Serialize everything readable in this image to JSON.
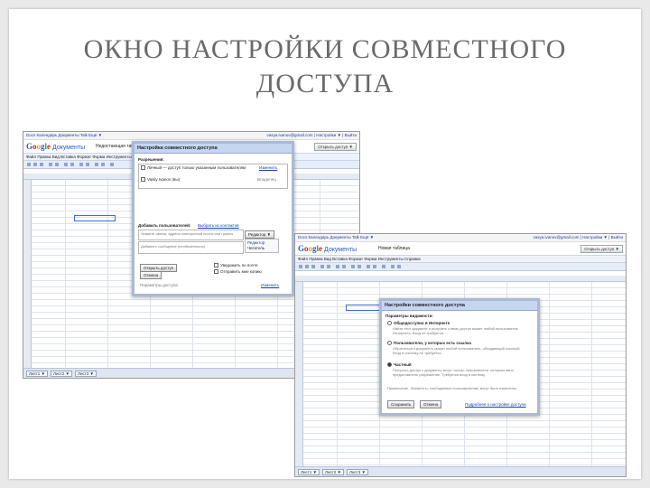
{
  "slide": {
    "title_line1": "ОКНО НАСТРОЙКИ СОВМЕСТНОГО",
    "title_line2": "ДОСТУПА"
  },
  "shot1": {
    "top_links": "Docs  Календарь  Документы  Talk  Ещё ▼",
    "account": "vasya.ivanov@gmail.com | Настройки ▼ | Выйти",
    "app_name": "Документы",
    "doc_name": "Недостающая таблица",
    "share_button": "Открыть доступ ▼",
    "menu": "Файл  Правка  Вид  Вставка  Формат  Форма  Инструменты  Справка",
    "sheet_tabs": [
      "Лист1 ▼",
      "Лист2 ▼",
      "Лист3 ▼"
    ],
    "dialog": {
      "title": "Настройка совместного доступа",
      "permissions_label": "Разрешения:",
      "perm_row1": "Личный — доступ только указанным пользователям",
      "perm_row1_action": "Изменить",
      "perm_row2": "Vasily Ivanov (вы)",
      "perm_row2_role": "Владелец",
      "add_people_label": "Добавить пользователей:",
      "add_people_link": "Выбрать из контактов",
      "email_placeholder": "Укажите имена, адреса электронной почты или группы",
      "role_select": "Редактор ▼",
      "role_options": [
        "Редактор",
        "Читатель"
      ],
      "message_placeholder": "Добавить сообщение (необязательно)",
      "share_btn": "Открыть доступ",
      "cancel_btn": "Отмена",
      "notify_check": "Уведомить по почте",
      "copy_check": "Отправить мне копию",
      "footer_left": "Параметры доступа",
      "footer_link": "Изменить"
    }
  },
  "shot2": {
    "top_links": "Docs  Календарь  Документы  Talk  Ещё ▼",
    "account": "vasya.ivanov@gmail.com | Настройки ▼ | Выйти",
    "app_name": "Документы",
    "doc_name": "Новая таблица",
    "share_button": "Открыть доступ ▼",
    "menu": "Файл  Правка  Вид  Вставка  Формат  Форма  Инструменты  Справка",
    "sheet_tabs": [
      "Лист1 ▼",
      "Лист2 ▼",
      "Лист3 ▼"
    ],
    "dialog": {
      "title": "Настройки совместного доступа",
      "visibility_label": "Параметры видимости:",
      "opt1_title": "Общедоступно в Интернете",
      "opt1_desc": "Найти этот документ и получить к нему доступ может любой пользователь Интернета. Вход не требуется.",
      "opt2_title": "Пользователи, у которых есть ссылка",
      "opt2_desc": "Обратиться к документу может любой пользователь, обладающий ссылкой. Вход в систему не требуется.",
      "opt3_title": "Частный",
      "opt3_desc": "Получить доступ к документу могут только пользователи, которым явно предоставлено разрешение. Требуется вход в систему.",
      "note": "Примечание. Элементы, сообщаемые пользователям, могут быть изменены.",
      "save_btn": "Сохранить",
      "cancel_btn": "Отмена",
      "help_link": "Подробнее о настройке доступа"
    }
  },
  "colors": {
    "title_text": "#6a6a6a",
    "dialog_header": "#c6d6f0",
    "link": "#1a3eab"
  }
}
